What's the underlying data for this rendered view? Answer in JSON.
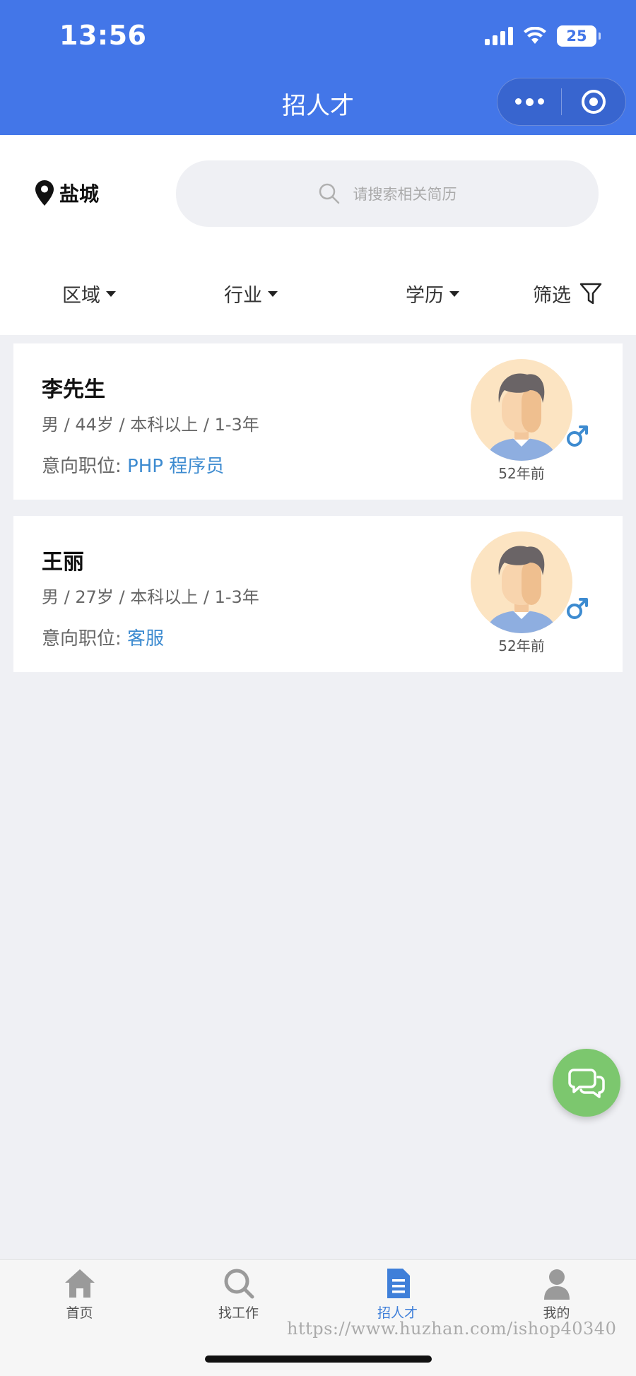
{
  "status_bar": {
    "time": "13:56",
    "battery": "25"
  },
  "nav": {
    "title": "招人才"
  },
  "location": {
    "city": "盐城"
  },
  "search": {
    "placeholder": "请搜索相关简历"
  },
  "filters": [
    {
      "label": "区域"
    },
    {
      "label": "行业"
    },
    {
      "label": "学历"
    },
    {
      "label": "筛选"
    }
  ],
  "candidates": [
    {
      "name": "李先生",
      "meta": "男 / 44岁 / 本科以上 / 1-3年",
      "intent_label": "意向职位:",
      "intent_job": "PHP 程序员",
      "time_ago": "52年前",
      "gender_icon": "male-icon"
    },
    {
      "name": "王丽",
      "meta": "男 / 27岁 / 本科以上 / 1-3年",
      "intent_label": "意向职位:",
      "intent_job": "客服",
      "time_ago": "52年前",
      "gender_icon": "male-icon"
    }
  ],
  "tabbar": [
    {
      "label": "首页",
      "icon": "home-icon"
    },
    {
      "label": "找工作",
      "icon": "search-icon"
    },
    {
      "label": "招人才",
      "icon": "document-icon",
      "active": true
    },
    {
      "label": "我的",
      "icon": "user-icon"
    }
  ],
  "watermark": "https://www.huzhan.com/ishop40340",
  "colors": {
    "primary": "#4376e8",
    "accent_text": "#3d8bd0",
    "chat_fab": "#7cc76e"
  }
}
